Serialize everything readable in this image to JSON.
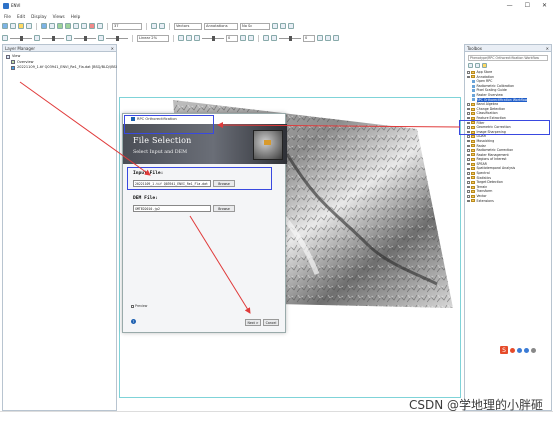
{
  "app": {
    "title": "ENVI",
    "window_controls": [
      "—",
      "☐",
      "✕"
    ],
    "menus": [
      "File",
      "Edit",
      "Display",
      "Views",
      "Help"
    ],
    "toolbar": {
      "zoom_value": "37",
      "vector_label": "Vectors",
      "annotations_label": "Annotations",
      "layout_value": "No Sc",
      "stretch_value": "Linear 2%",
      "opacity_value": "0",
      "rotate_value": "0"
    }
  },
  "layer_manager": {
    "title": "Layer Manager",
    "close": "✕",
    "items": [
      {
        "label": "View",
        "level": 0,
        "icon": "view"
      },
      {
        "label": "Overview",
        "level": 1,
        "icon": "overview"
      },
      {
        "label": "20221109_1.tif Q03941_ENVI_Re1_Fla.dat [BSQ/BLD/(BSQ)]",
        "level": 1,
        "icon": "layer"
      }
    ]
  },
  "toolbox": {
    "title": "Toolbox",
    "close": "✕",
    "search_text": "Phenotype/RPC Orthorectification Workflow",
    "items": [
      {
        "label": "App Store",
        "type": "folder",
        "level": 0
      },
      {
        "label": "Annotation",
        "type": "folder",
        "level": 0
      },
      {
        "label": "Open RPC",
        "type": "leaf",
        "level": 1
      },
      {
        "label": "Radiometric Calibration",
        "type": "leaf",
        "level": 1
      },
      {
        "label": "Pixel Scaling Guide",
        "type": "leaf",
        "level": 1
      },
      {
        "label": "Raster Overview",
        "type": "leaf",
        "level": 1
      },
      {
        "label": "RPC Orthorectification Workflow",
        "type": "leaf",
        "level": 1,
        "selected": true
      },
      {
        "label": "Band Algebra",
        "type": "folder",
        "level": 0
      },
      {
        "label": "Change Detection",
        "type": "folder",
        "level": 0
      },
      {
        "label": "Classification",
        "type": "folder",
        "level": 0
      },
      {
        "label": "Feature Extraction",
        "type": "folder",
        "level": 0
      },
      {
        "label": "Filter",
        "type": "folder",
        "level": 0
      },
      {
        "label": "Geometric Correction",
        "type": "folder",
        "level": 0
      },
      {
        "label": "Image Sharpening",
        "type": "folder",
        "level": 0
      },
      {
        "label": "LiDAR",
        "type": "folder",
        "level": 0
      },
      {
        "label": "Mosaicking",
        "type": "folder",
        "level": 0
      },
      {
        "label": "Radar",
        "type": "folder",
        "level": 0
      },
      {
        "label": "Radiometric Correction",
        "type": "folder",
        "level": 0
      },
      {
        "label": "Raster Management",
        "type": "folder",
        "level": 0
      },
      {
        "label": "Regions of Interest",
        "type": "folder",
        "level": 0
      },
      {
        "label": "SPEAR",
        "type": "folder",
        "level": 0
      },
      {
        "label": "Spatiotemporal Analysis",
        "type": "folder",
        "level": 0
      },
      {
        "label": "Spectral",
        "type": "folder",
        "level": 0
      },
      {
        "label": "Statistics",
        "type": "folder",
        "level": 0
      },
      {
        "label": "Target Detection",
        "type": "folder",
        "level": 0
      },
      {
        "label": "Terrain",
        "type": "folder",
        "level": 0
      },
      {
        "label": "Transform",
        "type": "folder",
        "level": 0
      },
      {
        "label": "Vector",
        "type": "folder",
        "level": 0
      },
      {
        "label": "Extensions",
        "type": "folder",
        "level": 0
      }
    ]
  },
  "dialog": {
    "title": "RPC Orthorectification",
    "heading": "File Selection",
    "subheading": "Select Input and DEM",
    "input_label": "Input File:",
    "input_value": "20221109_1.tif Q03941_ENVI_Re1_Fla.dat",
    "dem_label": "DEM File:",
    "dem_value": "GMTED2010.jp2",
    "browse_label": "Browse",
    "preview_label": "Preview",
    "help_label": "?",
    "next_label": "Next >",
    "cancel_label": "Cancel"
  },
  "watermark": "CSDN @学地理的小胖砸",
  "colors": {
    "highlight_box": "#3949e0",
    "arrow": "#e03a3a",
    "frame": "#7fd3d8",
    "selected": "#1e5cc8"
  }
}
